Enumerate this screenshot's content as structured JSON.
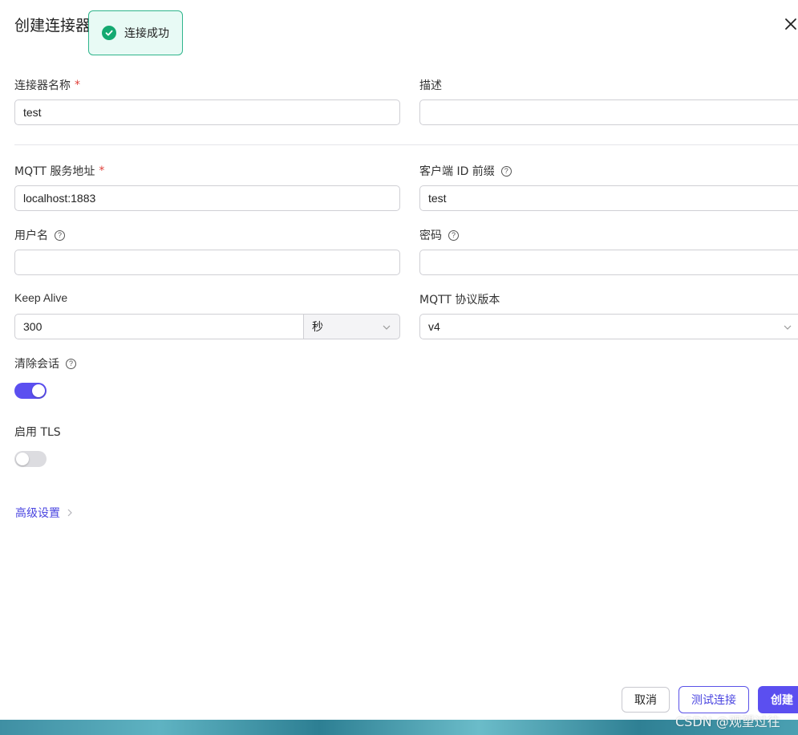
{
  "dialog": {
    "title": "创建连接器"
  },
  "toast": {
    "message": "连接成功"
  },
  "fields": {
    "name_label": "连接器名称",
    "name_value": "test",
    "description_label": "描述",
    "description_value": "",
    "server_label": "MQTT 服务地址",
    "server_value": "localhost:1883",
    "client_id_label": "客户端 ID 前缀",
    "client_id_value": "test",
    "username_label": "用户名",
    "username_value": "",
    "password_label": "密码",
    "password_value": "",
    "keepalive_label": "Keep Alive",
    "keepalive_value": "300",
    "keepalive_unit": "秒",
    "protocol_label": "MQTT 协议版本",
    "protocol_value": "v4",
    "clean_session_label": "清除会话",
    "clean_session_on": true,
    "tls_label": "启用 TLS",
    "tls_on": false
  },
  "advanced": {
    "label": "高级设置"
  },
  "footer": {
    "cancel_label": "取消",
    "test_label": "测试连接",
    "create_label": "创建"
  },
  "watermark": "CSDN @观望过往",
  "colors": {
    "accent": "#5b4ff0",
    "required": "#e0403a",
    "success": "#14a971",
    "toggle_off": "#dcdce0"
  },
  "icons": {
    "close": "close-icon",
    "success": "check-circle-icon",
    "help": "question-circle-icon",
    "dropdown": "chevron-down-icon",
    "advanced": "chevron-right-icon"
  }
}
